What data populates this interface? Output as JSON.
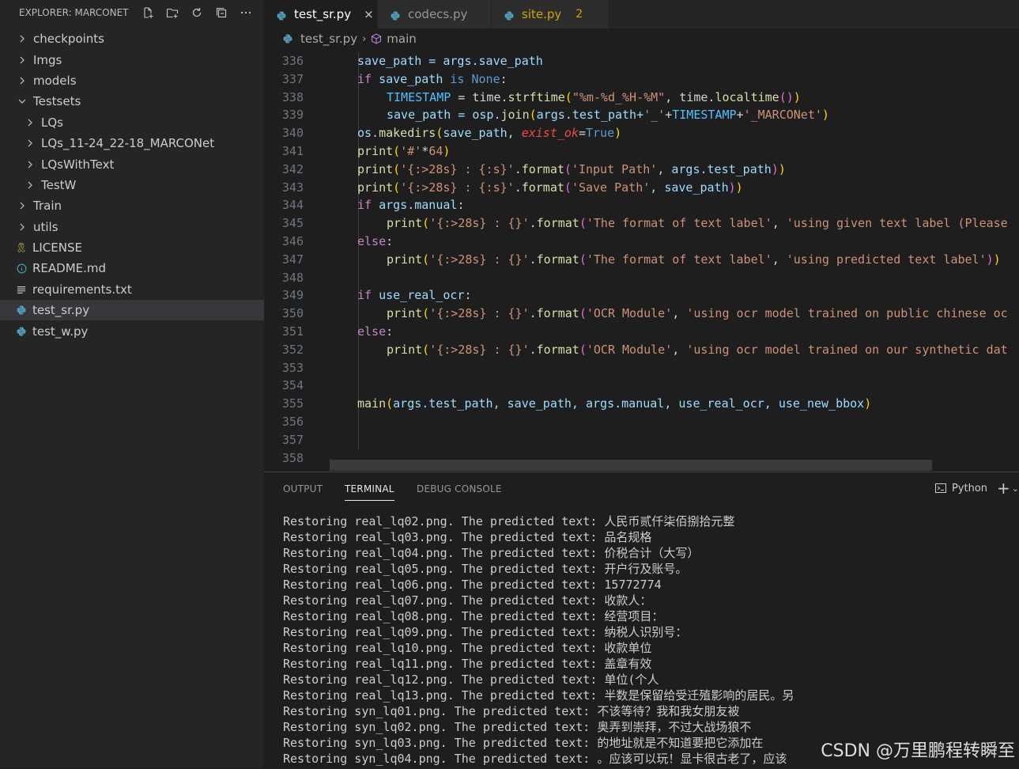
{
  "sidebar": {
    "title": "EXPLORER: MARCONET",
    "items": [
      {
        "label": "checkpoints",
        "type": "folder",
        "depth": 0
      },
      {
        "label": "Imgs",
        "type": "folder",
        "depth": 0
      },
      {
        "label": "models",
        "type": "folder",
        "depth": 0
      },
      {
        "label": "Testsets",
        "type": "folder-open",
        "depth": 0
      },
      {
        "label": "LQs",
        "type": "folder",
        "depth": 1
      },
      {
        "label": "LQs_11-24_22-18_MARCONet",
        "type": "folder",
        "depth": 1
      },
      {
        "label": "LQsWithText",
        "type": "folder",
        "depth": 1
      },
      {
        "label": "TestW",
        "type": "folder",
        "depth": 1
      },
      {
        "label": "Train",
        "type": "folder",
        "depth": 0
      },
      {
        "label": "utils",
        "type": "folder",
        "depth": 0
      },
      {
        "label": "LICENSE",
        "type": "license",
        "depth": 0
      },
      {
        "label": "README.md",
        "type": "info",
        "depth": 0
      },
      {
        "label": "requirements.txt",
        "type": "text",
        "depth": 0
      },
      {
        "label": "test_sr.py",
        "type": "python",
        "depth": 0,
        "selected": true
      },
      {
        "label": "test_w.py",
        "type": "python",
        "depth": 0
      }
    ]
  },
  "tabs": [
    {
      "label": "test_sr.py",
      "active": true,
      "close": "×"
    },
    {
      "label": "codecs.py",
      "active": false
    },
    {
      "label": "site.py",
      "active": false,
      "badge": "2"
    }
  ],
  "breadcrumb": {
    "file": "test_sr.py",
    "symbol": "main"
  },
  "editor": {
    "lines": [
      {
        "n": "336",
        "indent": 1,
        "tokens": [
          [
            "save_path = args.save_path",
            "var"
          ]
        ]
      },
      {
        "n": "337",
        "indent": 1,
        "tokens": [
          [
            "if",
            "kw"
          ],
          [
            " save_path ",
            "var"
          ],
          [
            "is",
            "c1"
          ],
          [
            " ",
            ""
          ],
          [
            "None",
            "c1"
          ],
          [
            ":",
            ""
          ]
        ]
      },
      {
        "n": "338",
        "indent": 2,
        "tokens": [
          [
            "TIMESTAMP",
            "vc"
          ],
          [
            " = time.",
            ""
          ],
          [
            "strftime",
            "fn"
          ],
          [
            "(",
            "br1"
          ],
          [
            "\"%m-%d_%H-%M\"",
            "str"
          ],
          [
            ", time.",
            ""
          ],
          [
            "localtime",
            "fn"
          ],
          [
            "()",
            "br2"
          ],
          [
            ")",
            "br1"
          ]
        ]
      },
      {
        "n": "339",
        "indent": 2,
        "tokens": [
          [
            "save_path = osp.",
            "var"
          ],
          [
            "join",
            "fn"
          ],
          [
            "(",
            "br1"
          ],
          [
            "args.test_path+",
            "var"
          ],
          [
            "'_'",
            "str"
          ],
          [
            "+",
            ""
          ],
          [
            "TIMESTAMP",
            "vc"
          ],
          [
            "+",
            ""
          ],
          [
            "'_MARCONet'",
            "str"
          ],
          [
            ")",
            "br1"
          ]
        ]
      },
      {
        "n": "340",
        "indent": 1,
        "tokens": [
          [
            "os.",
            "var"
          ],
          [
            "makedirs",
            "fn"
          ],
          [
            "(",
            "br1"
          ],
          [
            "save_path, ",
            "var"
          ],
          [
            "exist_ok",
            "prm"
          ],
          [
            "=",
            ""
          ],
          [
            "True",
            "c1"
          ],
          [
            ")",
            "br1"
          ]
        ]
      },
      {
        "n": "341",
        "indent": 1,
        "tokens": [
          [
            "print",
            "fn"
          ],
          [
            "(",
            "br1"
          ],
          [
            "'#'",
            "str"
          ],
          [
            "*",
            ""
          ],
          [
            "64",
            "str"
          ],
          [
            ")",
            "br1"
          ]
        ]
      },
      {
        "n": "342",
        "indent": 1,
        "tokens": [
          [
            "print",
            "fn"
          ],
          [
            "(",
            "br1"
          ],
          [
            "'{:>28s} : {:s}'",
            "str"
          ],
          [
            ".",
            ""
          ],
          [
            "format",
            "fn"
          ],
          [
            "(",
            "br2"
          ],
          [
            "'Input Path'",
            "str"
          ],
          [
            ", args.test_path",
            "var"
          ],
          [
            ")",
            "br2"
          ],
          [
            ")",
            "br1"
          ]
        ]
      },
      {
        "n": "343",
        "indent": 1,
        "tokens": [
          [
            "print",
            "fn"
          ],
          [
            "(",
            "br1"
          ],
          [
            "'{:>28s} : {:s}'",
            "str"
          ],
          [
            ".",
            ""
          ],
          [
            "format",
            "fn"
          ],
          [
            "(",
            "br2"
          ],
          [
            "'Save Path'",
            "str"
          ],
          [
            ", save_path",
            "var"
          ],
          [
            ")",
            "br2"
          ],
          [
            ")",
            "br1"
          ]
        ]
      },
      {
        "n": "344",
        "indent": 1,
        "tokens": [
          [
            "if",
            "kw"
          ],
          [
            " args.manual",
            "var"
          ],
          [
            ":",
            ""
          ]
        ]
      },
      {
        "n": "345",
        "indent": 2,
        "tokens": [
          [
            "print",
            "fn"
          ],
          [
            "(",
            "br1"
          ],
          [
            "'{:>28s} : {}'",
            "str"
          ],
          [
            ".",
            ""
          ],
          [
            "format",
            "fn"
          ],
          [
            "(",
            "br2"
          ],
          [
            "'The format of text label'",
            "str"
          ],
          [
            ", ",
            ""
          ],
          [
            "'using given text label (Please",
            "str"
          ]
        ]
      },
      {
        "n": "346",
        "indent": 1,
        "tokens": [
          [
            "else",
            "kw"
          ],
          [
            ":",
            ""
          ]
        ]
      },
      {
        "n": "347",
        "indent": 2,
        "tokens": [
          [
            "print",
            "fn"
          ],
          [
            "(",
            "br1"
          ],
          [
            "'{:>28s} : {}'",
            "str"
          ],
          [
            ".",
            ""
          ],
          [
            "format",
            "fn"
          ],
          [
            "(",
            "br2"
          ],
          [
            "'The format of text label'",
            "str"
          ],
          [
            ", ",
            ""
          ],
          [
            "'using predicted text label'",
            "str"
          ],
          [
            ")",
            "br2"
          ],
          [
            ")",
            "br1"
          ]
        ]
      },
      {
        "n": "348",
        "indent": 1,
        "tokens": []
      },
      {
        "n": "349",
        "indent": 1,
        "tokens": [
          [
            "if",
            "kw"
          ],
          [
            " use_real_ocr",
            "var"
          ],
          [
            ":",
            ""
          ]
        ]
      },
      {
        "n": "350",
        "indent": 2,
        "tokens": [
          [
            "print",
            "fn"
          ],
          [
            "(",
            "br1"
          ],
          [
            "'{:>28s} : {}'",
            "str"
          ],
          [
            ".",
            ""
          ],
          [
            "format",
            "fn"
          ],
          [
            "(",
            "br2"
          ],
          [
            "'OCR Module'",
            "str"
          ],
          [
            ", ",
            ""
          ],
          [
            "'using ocr model trained on public chinese oc",
            "str"
          ]
        ]
      },
      {
        "n": "351",
        "indent": 1,
        "tokens": [
          [
            "else",
            "kw"
          ],
          [
            ":",
            ""
          ]
        ]
      },
      {
        "n": "352",
        "indent": 2,
        "tokens": [
          [
            "print",
            "fn"
          ],
          [
            "(",
            "br1"
          ],
          [
            "'{:>28s} : {}'",
            "str"
          ],
          [
            ".",
            ""
          ],
          [
            "format",
            "fn"
          ],
          [
            "(",
            "br2"
          ],
          [
            "'OCR Module'",
            "str"
          ],
          [
            ", ",
            ""
          ],
          [
            "'using ocr model trained on our synthetic dat",
            "str"
          ]
        ]
      },
      {
        "n": "353",
        "indent": 1,
        "tokens": []
      },
      {
        "n": "354",
        "indent": 1,
        "tokens": []
      },
      {
        "n": "355",
        "indent": 1,
        "tokens": [
          [
            "main",
            "fn"
          ],
          [
            "(",
            "br1"
          ],
          [
            "args.test_path, save_path, args.manual, use_real_ocr, use_new_bbox",
            "var"
          ],
          [
            ")",
            "br1"
          ]
        ]
      },
      {
        "n": "356",
        "indent": 1,
        "tokens": []
      },
      {
        "n": "357",
        "indent": 1,
        "tokens": []
      },
      {
        "n": "358",
        "indent": 0,
        "tokens": []
      }
    ]
  },
  "panel": {
    "tabs": [
      {
        "label": "OUTPUT",
        "active": false
      },
      {
        "label": "TERMINAL",
        "active": true
      },
      {
        "label": "DEBUG CONSOLE",
        "active": false
      }
    ],
    "shell": "Python",
    "terminal_lines": [
      "Restoring real_lq02.png. The predicted text: 人民币贰仟柒佰捌拾元整",
      "Restoring real_lq03.png. The predicted text: 品名规格",
      "Restoring real_lq04.png. The predicted text: 价税合计（大写）",
      "Restoring real_lq05.png. The predicted text: 开户行及账号。",
      "Restoring real_lq06.png. The predicted text: 15772774",
      "Restoring real_lq07.png. The predicted text: 收款人：",
      "Restoring real_lq08.png. The predicted text: 经营项目：",
      "Restoring real_lq09.png. The predicted text: 纳税人识别号：",
      "Restoring real_lq10.png. The predicted text: 收款单位",
      "Restoring real_lq11.png. The predicted text: 盖章有效",
      "Restoring real_lq12.png. The predicted text: 单位(个人",
      "Restoring real_lq13.png. The predicted text: 半数是保留给受迁殖影响的居民。另",
      "Restoring syn_lq01.png. The predicted text: 不该等待？我和我女朋友被",
      "Restoring syn_lq02.png. The predicted text: 奥弄到崇拜，不过大战场狼不",
      "Restoring syn_lq03.png. The predicted text: 的地址就是不知道要把它添加在",
      "Restoring syn_lq04.png. The predicted text: 。应该可以玩！显卡很古老了，应该"
    ]
  },
  "watermark": "CSDN @万里鹏程转瞬至",
  "colors": {
    "accent_python": "#519aba",
    "warning": "#cca700"
  }
}
